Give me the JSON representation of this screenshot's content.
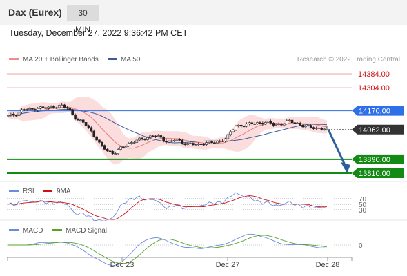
{
  "header": {
    "title": "Dax (Eurex)",
    "interval": "30 MIN"
  },
  "datetime": "Tuesday, December 27, 2022 9:36:42 PM CET",
  "legend": {
    "bb_label": "MA 20 + Bollinger Bands",
    "ma50_label": "MA 50",
    "credit": "Research © 2022 Trading Central",
    "rsi_label": "RSI",
    "rsi_ma_label": "9MA",
    "macd_label": "MACD",
    "macd_signal_label": "MACD Signal"
  },
  "levels": [
    {
      "value": 14384.0,
      "label": "14384.00",
      "kind": "resistance-faint",
      "color": "#f0a0a0"
    },
    {
      "value": 14304.0,
      "label": "14304.00",
      "kind": "resistance-faint",
      "color": "#f0a0a0"
    },
    {
      "value": 14170.0,
      "label": "14170.00",
      "kind": "pivot",
      "color": "#2f6fe8"
    },
    {
      "value": 14062.0,
      "label": "14062.00",
      "kind": "last",
      "color": "#333333"
    },
    {
      "value": 13890.0,
      "label": "13890.00",
      "kind": "support",
      "color": "#138a13"
    },
    {
      "value": 13810.0,
      "label": "13810.00",
      "kind": "support",
      "color": "#138a13"
    }
  ],
  "rsi_axis": {
    "labels": [
      "70",
      "50",
      "30"
    ]
  },
  "macd_axis": {
    "labels": [
      "0"
    ]
  },
  "x_axis": {
    "labels": [
      "Dec 23",
      "Dec 27",
      "Dec 28"
    ]
  },
  "colors": {
    "ma20": "#e87b7b",
    "band": "#fbd4d4",
    "ma50": "#3a5a9a",
    "up": "#ffffff",
    "down": "#222222",
    "rsi": "#6b8be0",
    "rsi_ma": "#d01010",
    "macd": "#6b8be0",
    "macd_signal": "#5aa02c",
    "forecast_arrow": "#2a6099"
  },
  "chart_data": {
    "type": "candlestick",
    "title": "Dax (Eurex)",
    "timeframe": "30 MIN",
    "x_labels": [
      "Dec 23",
      "Dec 27",
      "Dec 28"
    ],
    "close_path": [
      14140,
      14150,
      14180,
      14175,
      14190,
      14185,
      14195,
      14200,
      14180,
      14120,
      14100,
      14050,
      13980,
      13940,
      13925,
      13960,
      13985,
      14000,
      14010,
      14030,
      14015,
      13990,
      14005,
      13985,
      13980,
      13970,
      13990,
      13985,
      13995,
      14030,
      14080,
      14090,
      14095,
      14100,
      14105,
      14090,
      14095,
      14110,
      14100,
      14080,
      14075,
      14070,
      14062
    ],
    "horizontal_levels": [
      14384.0,
      14304.0,
      14170.0,
      14062.0,
      13890.0,
      13810.0
    ],
    "last_price": 14062.0,
    "forecast_target": 13810.0,
    "ylim": [
      13800,
      14400
    ],
    "indicators": [
      "MA 20 + Bollinger Bands",
      "MA 50",
      "RSI",
      "9MA",
      "MACD",
      "MACD Signal"
    ]
  }
}
